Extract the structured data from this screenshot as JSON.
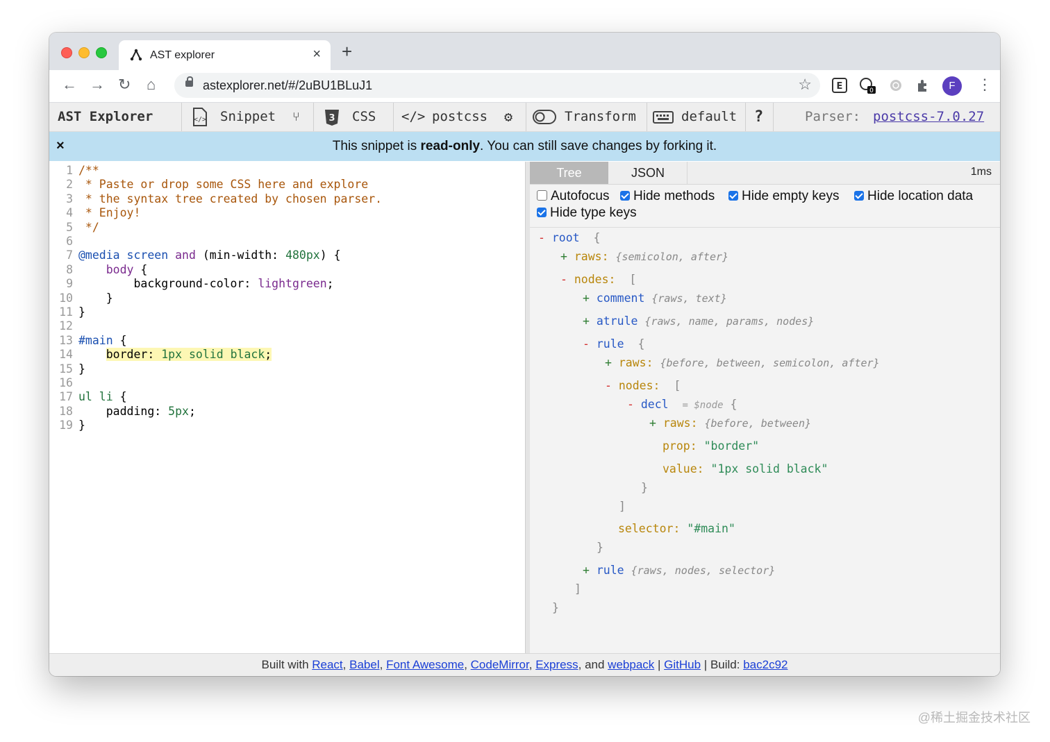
{
  "browser": {
    "tab_title": "AST explorer",
    "tab_close": "×",
    "new_tab": "+",
    "url": "astexplorer.net/#/2uBU1BLuJ1",
    "avatar_letter": "F",
    "ext_badge": "0"
  },
  "navbar": {
    "brand": "AST Explorer",
    "snippet": "Snippet",
    "language": "CSS",
    "parser_name": "postcss",
    "transform": "Transform",
    "keymap": "default",
    "help": "?",
    "parser_label": "Parser:",
    "parser_version": "postcss-7.0.27"
  },
  "banner": {
    "close": "×",
    "text_before": "This snippet is ",
    "text_bold": "read-only",
    "text_after": ". You can still save changes by forking it."
  },
  "editor": {
    "line_numbers": [
      "1",
      "2",
      "3",
      "4",
      "5",
      "6",
      "7",
      "8",
      "9",
      "10",
      "11",
      "12",
      "13",
      "14",
      "15",
      "16",
      "17",
      "18",
      "19"
    ],
    "l1": "/**",
    "l2": " * Paste or drop some CSS here and explore",
    "l3": " * the syntax tree created by chosen parser.",
    "l4": " * Enjoy!",
    "l5": " */",
    "l7_at": "@media",
    "l7_screen": "screen",
    "l7_and": "and",
    "l7_open": "(min-width:",
    "l7_num": "480px",
    "l7_close": ") {",
    "l8": "body",
    "l8b": " {",
    "l9_prop": "background-color:",
    "l9_val": "lightgreen",
    "l9_end": ";",
    "l10": "}",
    "l11": "}",
    "l13_sel": "#main",
    "l13_b": " {",
    "l14_prop": "border:",
    "l14_num": "1px",
    "l14_val": "solid black",
    "l14_end": ";",
    "l15": "}",
    "l17_sel": "ul li",
    "l17_b": " {",
    "l18_prop": "padding:",
    "l18_num": "5px",
    "l18_end": ";",
    "l19": "}"
  },
  "output": {
    "tab_tree": "Tree",
    "tab_json": "JSON",
    "time": "1ms",
    "options": [
      {
        "label": "Autofocus",
        "checked": false
      },
      {
        "label": "Hide methods",
        "checked": true
      },
      {
        "label": "Hide empty keys",
        "checked": true
      },
      {
        "label": "Hide location data",
        "checked": true
      },
      {
        "label": "Hide type keys",
        "checked": true
      }
    ],
    "tree": {
      "root": "root",
      "raws": "raws:",
      "root_raws_sum": "{semicolon, after}",
      "nodes": "nodes:",
      "comment": "comment",
      "comment_sum": "{raws, text}",
      "atrule": "atrule",
      "atrule_sum": "{raws, name, params, nodes}",
      "rule": "rule",
      "rule_raws_sum": "{before, between, semicolon, after}",
      "decl": "decl",
      "decl_ref": "= $node",
      "decl_raws_sum": "{before, between}",
      "prop_key": "prop:",
      "prop_val": "\"border\"",
      "value_key": "value:",
      "value_val": "\"1px solid black\"",
      "selector_key": "selector:",
      "selector_val": "\"#main\"",
      "rule2_sum": "{raws, nodes, selector}"
    }
  },
  "footer": {
    "built_with": "Built with ",
    "links": [
      "React",
      "Babel",
      "Font Awesome",
      "CodeMirror",
      "Express",
      "webpack"
    ],
    "and": "and ",
    "github": "GitHub",
    "build_label": "Build: ",
    "build_hash": "bac2c92"
  },
  "watermark": "@稀土掘金技术社区"
}
